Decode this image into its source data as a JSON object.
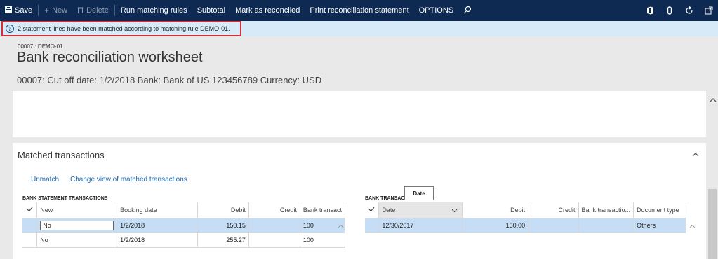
{
  "actionbar": {
    "save": "Save",
    "new": "New",
    "delete": "Delete",
    "run_matching": "Run matching rules",
    "subtotal": "Subtotal",
    "mark_reconciled": "Mark as reconciled",
    "print_statement": "Print reconciliation statement",
    "options": "OPTIONS"
  },
  "message": {
    "info_glyph": "i",
    "text": "2 statement lines have been matched according to matching rule DEMO-01."
  },
  "header": {
    "crumb": "00007 : DEMO-01",
    "title": "Bank reconciliation worksheet",
    "subtitle": "00007: Cut off date: 1/2/2018 Bank: Bank of US 123456789 Currency: USD"
  },
  "matched": {
    "title": "Matched transactions",
    "unmatch": "Unmatch",
    "change_view": "Change view of matched transactions"
  },
  "bank_statement": {
    "title": "BANK STATEMENT TRANSACTIONS",
    "columns": [
      "New",
      "Booking date",
      "Debit",
      "Credit",
      "Bank transact"
    ],
    "rows": [
      {
        "new": "No",
        "booking_date": "1/2/2018",
        "debit": "150.15",
        "credit": "",
        "bank_tx": "100"
      },
      {
        "new": "No",
        "booking_date": "1/2/2018",
        "debit": "255.27",
        "credit": "",
        "bank_tx": "100"
      }
    ]
  },
  "bank_transactions": {
    "title": "BANK TRANSAC",
    "columns": [
      "Date",
      "Debit",
      "Credit",
      "Bank transactio...",
      "Document type"
    ],
    "rows": [
      {
        "date": "12/30/2017",
        "debit": "150.00",
        "credit": "",
        "bank_tx": "",
        "doc_type": "Others"
      }
    ]
  },
  "tooltip": "Date",
  "colors": {
    "actionbar": "#0f2a52",
    "message_bg": "#d6eaf8",
    "highlight_border": "#d0323c",
    "selected_row": "#c6def5",
    "link": "#1f6cb0"
  }
}
